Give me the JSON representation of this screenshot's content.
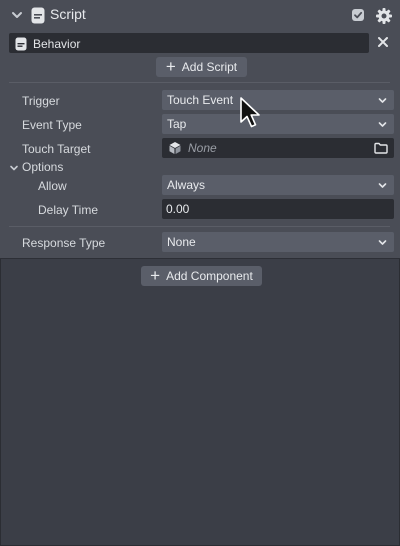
{
  "component": {
    "title": "Script",
    "enabled": true,
    "script_name": "Behavior",
    "add_script_label": "Add Script"
  },
  "fields": {
    "trigger": {
      "label": "Trigger",
      "value": "Touch Event"
    },
    "event_type": {
      "label": "Event Type",
      "value": "Tap"
    },
    "touch_target": {
      "label": "Touch Target",
      "value": "None"
    },
    "options": {
      "label": "Options",
      "allow": {
        "label": "Allow",
        "value": "Always"
      },
      "delay_time": {
        "label": "Delay Time",
        "value": "0.00"
      }
    },
    "response_type": {
      "label": "Response Type",
      "value": "None"
    }
  },
  "footer": {
    "add_component_label": "Add Component"
  },
  "icons": {
    "collapse": "chevron-down-icon",
    "script": "script-file-icon",
    "checkbox": "checkmark-icon",
    "settings": "gear-icon",
    "remove": "close-icon",
    "add": "plus-icon",
    "dropdown": "chevron-down-icon",
    "object": "cube-icon",
    "browse": "folder-icon",
    "pointer": "mouse-cursor-icon"
  },
  "colors": {
    "background": "#3b3e47",
    "panel": "#4a4d56",
    "control": "#5a5e69",
    "input": "#2b2d33",
    "text": "#e8eaed"
  }
}
